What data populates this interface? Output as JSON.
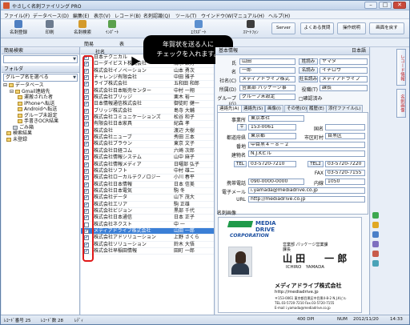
{
  "window": {
    "title": "やさしく名刺ファイリング PRO"
  },
  "menu": [
    "ファイル(F)",
    "データベース(D)",
    "編集(E)",
    "表示(V)",
    "レコード(B)",
    "名刺認識(Q)",
    "ツール(T)",
    "ウインドウ(W)",
    "マニュアル(H)",
    "ヘルプ(H)"
  ],
  "toolbar": {
    "buttons": [
      "名刺登録",
      "印刷",
      "名刺検索",
      "ｲﾝﾎﾟｰﾄ",
      "ｴｸｽﾎﾟｰﾄ",
      "ｽﾏｰﾄﾌｫﾝ",
      "Server",
      "よくある質問",
      "操作説明",
      "画面を戻す"
    ]
  },
  "secondbar": {
    "label1": "簡易",
    "label2": "表"
  },
  "callout": {
    "line1": "年賀状を送る人に",
    "line2": "チェックを入れます。"
  },
  "left": {
    "search_head": "簡易検索",
    "folder_head": "フォルダ",
    "group_select": "グループ名を選べる",
    "tree": [
      "データベース",
      "Gmail連絡先",
      "運搬された者",
      "iPhoneへ転送",
      "Androidへ転送",
      "グループ未設定",
      "手書きOCR結果",
      "ごみ箱",
      "検索結果",
      "未登録"
    ]
  },
  "list": {
    "col_name": "社名",
    "col_person": "氏名",
    "rows": [
      {
        "company": "日本テクニカル",
        "person": "大森 正人",
        "checked": true
      },
      {
        "company": "ローダイビスト株式会社",
        "person": "清水 鉄男",
        "checked": true
      },
      {
        "company": "株式会社イノベーション",
        "person": "山本 勇次",
        "checked": true
      },
      {
        "company": "チャレンジ有限会社",
        "person": "中田 雅子",
        "checked": true
      },
      {
        "company": "ライブ株式会社",
        "person": "五和田 和郎",
        "checked": true
      },
      {
        "company": "株式会社日本販売センター",
        "person": "中村 一翔",
        "checked": true
      },
      {
        "company": "株式会社ブリッジ",
        "person": "栗木 裕一",
        "checked": true
      },
      {
        "company": "日本情報通信株式会社",
        "person": "御徒町 健一",
        "checked": true
      },
      {
        "company": "ブリッジ株式会社",
        "person": "島寺 大輔",
        "checked": true
      },
      {
        "company": "株式会社コミュニケーションズ",
        "person": "松谷 和子",
        "checked": true
      },
      {
        "company": "有限会社日本家具",
        "person": "紀森 孝",
        "checked": true
      },
      {
        "company": "株式会社",
        "person": "渡辺 大樹",
        "checked": true
      },
      {
        "company": "株式会社ニューブ",
        "person": "秀田 三本",
        "checked": true
      },
      {
        "company": "株式会社ブラウン",
        "person": "東京 文子",
        "checked": true
      },
      {
        "company": "株式会社日経コム",
        "person": "六崎 次郎",
        "checked": true
      },
      {
        "company": "株式会社情報システム",
        "person": "山中 麻子",
        "checked": true
      },
      {
        "company": "株式会社情報メディア",
        "person": "日曜部 弘子",
        "checked": true
      },
      {
        "company": "株式会社ソフト",
        "person": "中村 雄二",
        "checked": true
      },
      {
        "company": "株式会社ローカルテクノロジー",
        "person": "小川 春平",
        "checked": true
      },
      {
        "company": "株式会社日本情報",
        "person": "日本 信美",
        "checked": true
      },
      {
        "company": "株式会社日本電気",
        "person": "駒 冬",
        "checked": true
      },
      {
        "company": "株式会社データ",
        "person": "山下 茂大",
        "checked": true
      },
      {
        "company": "株式会社エリア",
        "person": "駒 正雄",
        "checked": true
      },
      {
        "company": "株式会社ビジョン",
        "person": "黒部 千代",
        "checked": true
      },
      {
        "company": "株式会社日本通信",
        "person": "日本 正子",
        "checked": true
      },
      {
        "company": "株式会社ネクスト",
        "person": "中 一",
        "checked": false
      },
      {
        "company": "メディアドライブ株式会社",
        "person": "山田 一郎",
        "checked": true,
        "selected": true
      },
      {
        "company": "株式会社アドソリューション",
        "person": "上野 さくら",
        "checked": true
      },
      {
        "company": "株式会社ソリューション",
        "person": "鈴木 大悟",
        "checked": true
      },
      {
        "company": "株式会社早稲田情報",
        "person": "田町 一郎",
        "checked": true
      }
    ]
  },
  "detail": {
    "head": "基本情報",
    "lang": "日本語",
    "fields": {
      "surname_label": "氏",
      "surname": "山田",
      "surname_kana_btn": "姓読み",
      "surname_kana": "ヤマダ",
      "given_label": "名",
      "given": "一郎",
      "given_kana_btn": "名読み",
      "given_kana": "イチロウ",
      "company_label": "社名(C)",
      "company": "メディアドライブ株式",
      "company_kana_btn": "社名読み",
      "company_kana": "メディアドライブ",
      "dept_label": "所属(D)",
      "dept": "営業部 パッケージ事",
      "title_label": "役職(T)",
      "title": "課長",
      "group_label": "グループ(G)",
      "group": "グループ未設定",
      "sync_label": "□確認済み"
    },
    "tabs": [
      "連絡先(A)",
      "連絡先(S)",
      "画像(I)",
      "その他(O)",
      "履歴(E)",
      "添付ファイル(L)"
    ],
    "contact": {
      "office_label": "事業所",
      "office": "東京本社",
      "zip_label": "〒",
      "zip": "153-0061",
      "country_label": "国名",
      "pref_label": "都道府県",
      "pref": "東京都",
      "city_label": "市区町村",
      "city": "目黒区",
      "addr_label": "番地",
      "addr": "中目黒４－８－２",
      "bldg_label": "建物名",
      "bldg": "N.J.Kビル",
      "tel_label": "TEL",
      "tel": "03-5720-7210",
      "tel2_label": "TEL2",
      "tel2": "03-5720-7220",
      "fax_label": "FAX",
      "fax": "03-5720-7155",
      "mobile_label": "携帯電話",
      "mobile": "090-0000-0000",
      "ext_label": "内線",
      "ext": "1050",
      "email_label": "電子メール",
      "email": "i.yamada@mediadrive.co.jp",
      "url_label": "URL",
      "url": "http://mediadrive.co.jp"
    },
    "card": {
      "head": "名刺画像",
      "logo1": "MEDIA",
      "logo2": "DRIVE",
      "logo3": "CORPORATION",
      "dept": "営業部 パッケージ営業課",
      "title": "課長",
      "name": "山 田　　一 郎",
      "name_romaji": "ICHIRO　YAMADA",
      "company": "メディアドライブ株式会社",
      "url": "http://mediadrive.jp",
      "address": "〒153-0061 東京都目黒区中目黒4-8-2 N.J.Kビル",
      "tel": "TEL.03-5720-7210 Fax.03-5720-7155",
      "email": "E-mail i.yamada@mediadrive.co.jp"
    }
  },
  "vsidebar": {
    "tab1": "レコード情報",
    "tab2": "名刺画像"
  },
  "status": {
    "record": "ﾚｺｰﾄﾞ番号 25",
    "count": "ﾚｺｰﾄﾞ数 28",
    "ready": "ﾚﾃﾞｨ",
    "dpi": "400 DPI",
    "num": "NUM",
    "date": "2012/11/20",
    "time": "14:33"
  }
}
